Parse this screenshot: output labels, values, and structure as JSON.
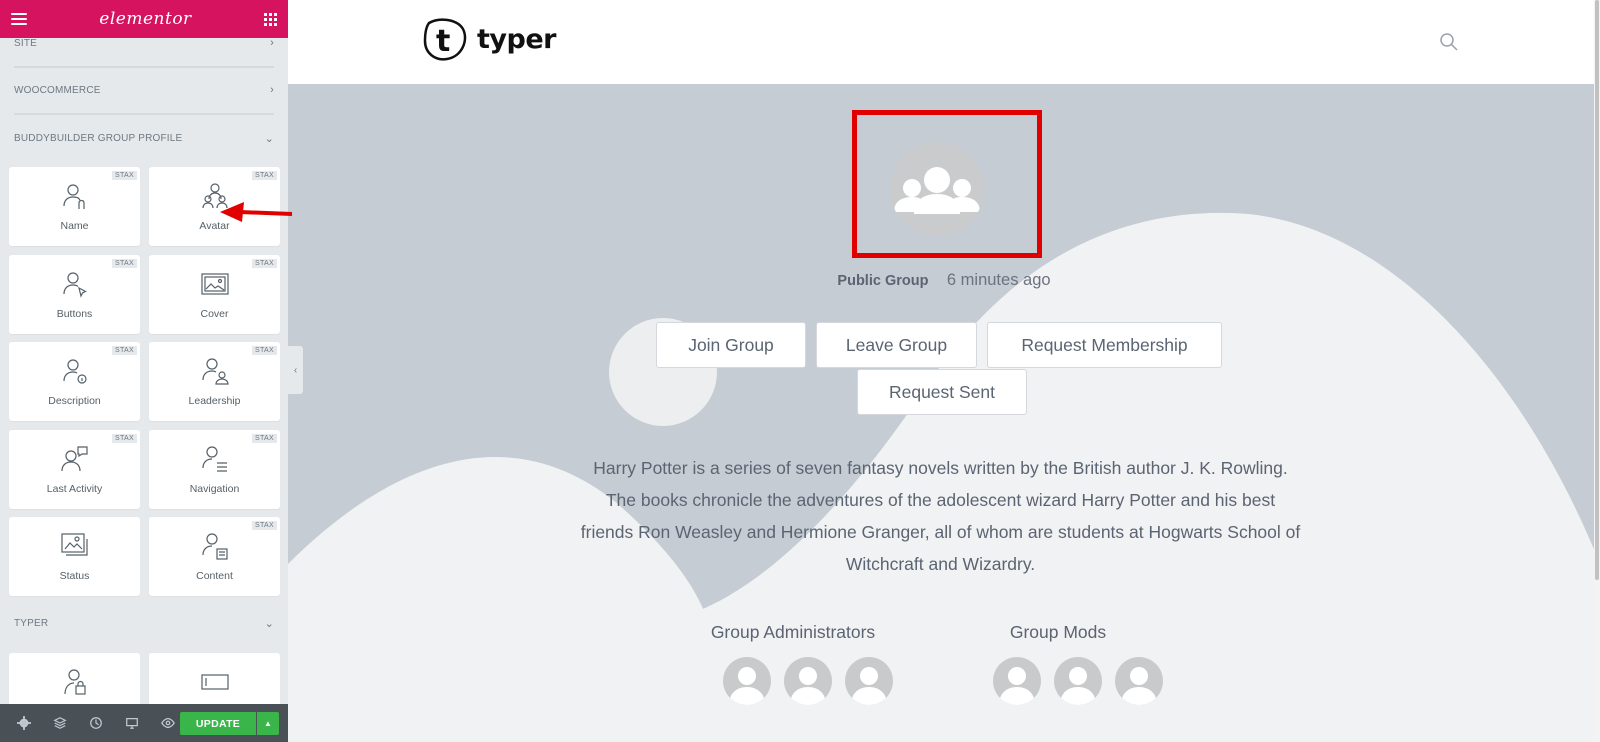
{
  "editor": {
    "brand": "elementor",
    "categories": {
      "site": "SITE",
      "woocommerce": "WOOCOMMERCE",
      "buddybuilder": "BUDDYBUILDER GROUP PROFILE",
      "typer": "TYPER"
    },
    "pro_badge": "STAX",
    "widgets": [
      {
        "label": "Name",
        "icon": "user-n-icon"
      },
      {
        "label": "Avatar",
        "icon": "users-icon"
      },
      {
        "label": "Buttons",
        "icon": "user-cursor-icon"
      },
      {
        "label": "Cover",
        "icon": "image-frame-icon"
      },
      {
        "label": "Description",
        "icon": "user-info-icon"
      },
      {
        "label": "Leadership",
        "icon": "user-pair-icon"
      },
      {
        "label": "Last Activity",
        "icon": "user-chat-icon"
      },
      {
        "label": "Navigation",
        "icon": "user-list-icon"
      },
      {
        "label": "Status",
        "icon": "images-icon"
      },
      {
        "label": "Content",
        "icon": "user-content-icon"
      }
    ],
    "footer": {
      "update_label": "UPDATE"
    },
    "colors": {
      "header": "#d5135f",
      "update": "#39b54a",
      "footer": "#495157"
    }
  },
  "site": {
    "logo_text": "typer",
    "group": {
      "type": "Public Group",
      "time": "6 minutes ago",
      "buttons": {
        "join": "Join Group",
        "leave": "Leave Group",
        "request": "Request Membership",
        "sent": "Request Sent"
      },
      "description": "Harry Potter is a series of seven fantasy novels written by the British author J. K. Rowling. The books chronicle the adventures of the adolescent wizard Harry Potter and his best friends Ron Weasley and Hermione Granger, all of whom are students at Hogwarts School of Witchcraft and Wizardry.",
      "admins_title": "Group Administrators",
      "mods_title": "Group Mods"
    }
  }
}
